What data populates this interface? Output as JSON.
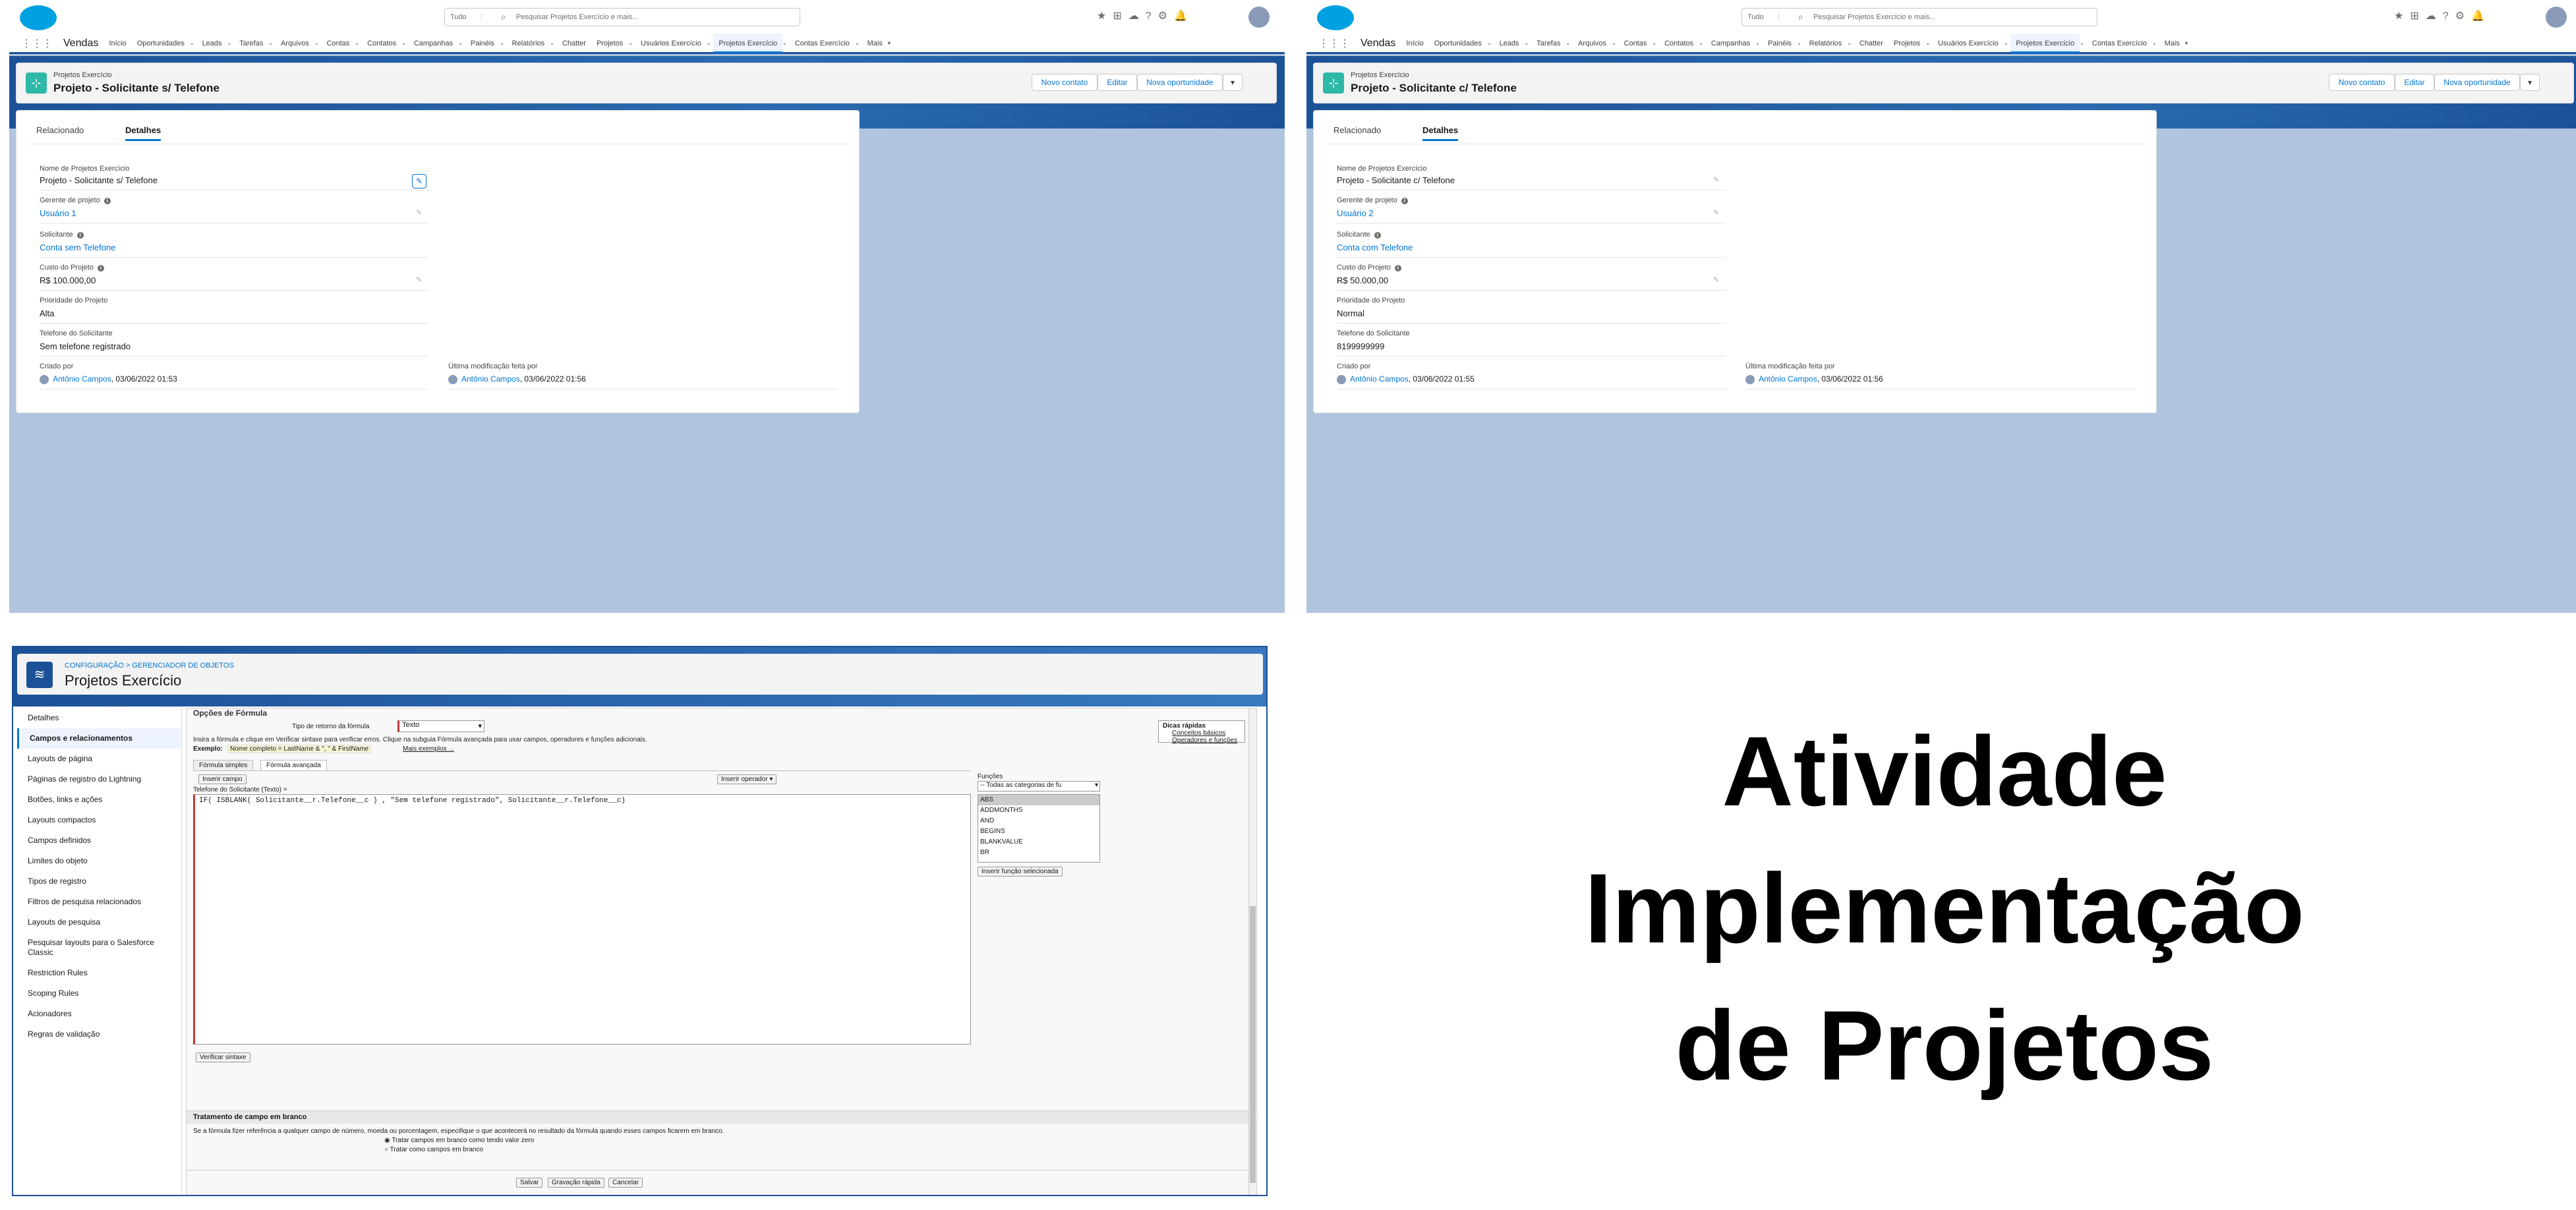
{
  "app": {
    "name": "Vendas",
    "search_scope": "Tudo",
    "search_placeholder": "Pesquisar Projetos Exercício e mais...",
    "nav_items": [
      "Início",
      "Oportunidades",
      "Leads",
      "Tarefas",
      "Arquivos",
      "Contas",
      "Contatos",
      "Campanhas",
      "Painéis",
      "Relatórios",
      "Chatter",
      "Projetos",
      "Usuários Exercício",
      "Projetos Exercício",
      "Contas Exercício",
      "Mais"
    ],
    "active_nav": "Projetos Exercício"
  },
  "record_left": {
    "object_label": "Projetos Exercício",
    "title": "Projeto - Solicitante s/ Telefone",
    "actions": [
      "Novo contato",
      "Editar",
      "Nova oportunidade"
    ],
    "tabs": [
      "Relacionado",
      "Detalhes"
    ],
    "active_tab": "Detalhes",
    "fields": {
      "nome_label": "Nome de Projetos Exercício",
      "nome_value": "Projeto - Solicitante s/ Telefone",
      "gerente_label": "Gerente de projeto",
      "gerente_value": "Usuário 1",
      "solicitante_label": "Solicitante",
      "solicitante_value": "Conta sem Telefone",
      "custo_label": "Custo do Projeto",
      "custo_value": "R$ 100.000,00",
      "prioridade_label": "Prioridade do Projeto",
      "prioridade_value": "Alta",
      "telefone_label": "Telefone do Solicitante",
      "telefone_value": "Sem telefone registrado",
      "criado_label": "Criado por",
      "criado_user": "Antônio Campos",
      "criado_date": ", 03/06/2022 01:53",
      "modificado_label": "Última modificação feita por",
      "modificado_user": "Antônio Campos",
      "modificado_date": ", 03/06/2022 01:56"
    }
  },
  "record_right": {
    "object_label": "Projetos Exercício",
    "title": "Projeto - Solicitante c/ Telefone",
    "actions": [
      "Novo contato",
      "Editar",
      "Nova oportunidade"
    ],
    "tabs": [
      "Relacionado",
      "Detalhes"
    ],
    "active_tab": "Detalhes",
    "fields": {
      "nome_label": "Nome de Projetos Exercício",
      "nome_value": "Projeto - Solicitante c/ Telefone",
      "gerente_label": "Gerente de projeto",
      "gerente_value": "Usuário 2",
      "solicitante_label": "Solicitante",
      "solicitante_value": "Conta com Telefone",
      "custo_label": "Custo do Projeto",
      "custo_value": "R$ 50.000,00",
      "prioridade_label": "Prioridade do Projeto",
      "prioridade_value": "Normal",
      "telefone_label": "Telefone do Solicitante",
      "telefone_value": "8199999999",
      "criado_label": "Criado por",
      "criado_user": "Antônio Campos",
      "criado_date": ", 03/06/2022 01:55",
      "modificado_label": "Última modificação feita por",
      "modificado_user": "Antônio Campos",
      "modificado_date": ", 03/06/2022 01:56"
    }
  },
  "setup": {
    "breadcrumb": "CONFIGURAÇÃO > GERENCIADOR DE OBJETOS",
    "title": "Projetos Exercício",
    "sidebar": [
      "Detalhes",
      "Campos e relacionamentos",
      "Layouts de página",
      "Páginas de registro do Lightning",
      "Botões, links e ações",
      "Layouts compactos",
      "Campos definidos",
      "Limites do objeto",
      "Tipos de registro",
      "Filtros de pesquisa relacionados",
      "Layouts de pesquisa",
      "Pesquisar layouts para o Salesforce Classic",
      "Restriction Rules",
      "Scoping Rules",
      "Acionadores",
      "Regras de validação"
    ],
    "active_sidebar": "Campos e relacionamentos",
    "section_title": "Opções de Fórmula",
    "return_type_label": "Tipo de retorno da fórmula",
    "return_type_value": "Texto",
    "instructions": "Insira a fórmula e clique em Verificar sintaxe para verificar erros. Clique na subguia Fórmula avançada para usar campos, operadores e funções adicionais.",
    "example": "Exemplo:",
    "example_value": "Nome completo = LastName & \", \" & FirstName",
    "more_examples": "Mais exemplos ...",
    "tip_title": "Dicas rápidas",
    "tip_links": [
      "Conceitos básicos",
      "Operadores e funções"
    ],
    "tabs": [
      "Fórmula simples",
      "Fórmula avançada"
    ],
    "insert_field": "Inserir campo",
    "insert_operator": "Inserir operador",
    "field_label": "Telefone do Solicitante (Texto) =",
    "formula": "IF( ISBLANK( Solicitante__r.Telefone__c ) , \"Sem telefone registrado\", Solicitante__r.Telefone__c)",
    "functions_label": "Funções",
    "functions_category": "-- Todas as categorias de fu",
    "functions": [
      "ABS",
      "ADDMONTHS",
      "AND",
      "BEGINS",
      "BLANKVALUE",
      "BR"
    ],
    "insert_function": "Inserir função selecionada",
    "check_syntax": "Verificar sintaxe",
    "blank_title": "Tratamento de campo em branco",
    "blank_desc": "Se a fórmula fizer referência a qualquer campo de número, moeda ou porcentagem, especifique o que acontecerá no resultado da fórmula quando esses campos ficarem em branco.",
    "blank_opt1": "Tratar campos em branco como tendo valor zero",
    "blank_opt2": "Tratar como campos em branco",
    "footer_buttons": [
      "Salvar",
      "Gravação rápida",
      "Cancelar"
    ]
  },
  "headline": {
    "line1": "Atividade",
    "line2": "Implementação",
    "line3": "de Projetos"
  },
  "colors": {
    "brand": "#0176d3",
    "nav_bar": "#1b5297",
    "background": "#b0c4df"
  }
}
